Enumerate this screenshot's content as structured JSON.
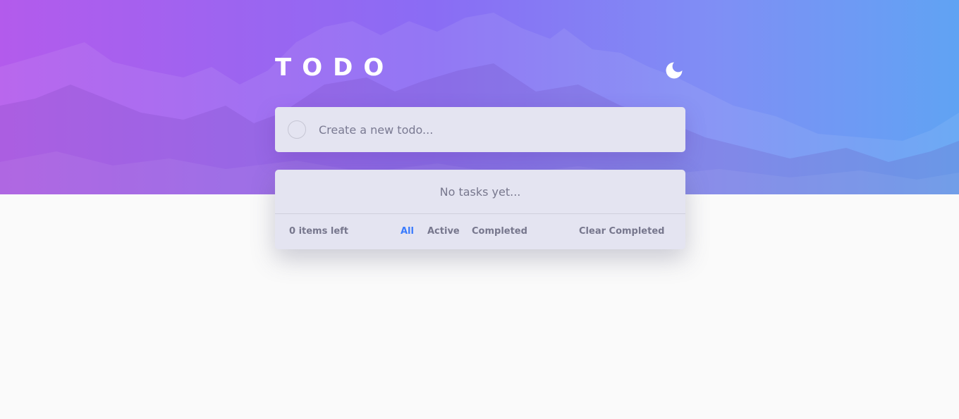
{
  "app": {
    "title": "TODO"
  },
  "theme_toggle": {
    "icon": "moon-icon"
  },
  "new_todo": {
    "placeholder": "Create a new todo...",
    "value": ""
  },
  "list": {
    "empty_text": "No tasks yet..."
  },
  "footer": {
    "items_left": "0 items left",
    "filters": [
      "All",
      "Active",
      "Completed"
    ],
    "active_filter": "All",
    "clear_label": "Clear Completed"
  },
  "colors": {
    "accent": "#3a7bfd",
    "card_bg": "#e4e4f1",
    "page_bg": "#fafafa",
    "hero_gradient_start": "#b35bec",
    "hero_gradient_end": "#60a3f3"
  }
}
